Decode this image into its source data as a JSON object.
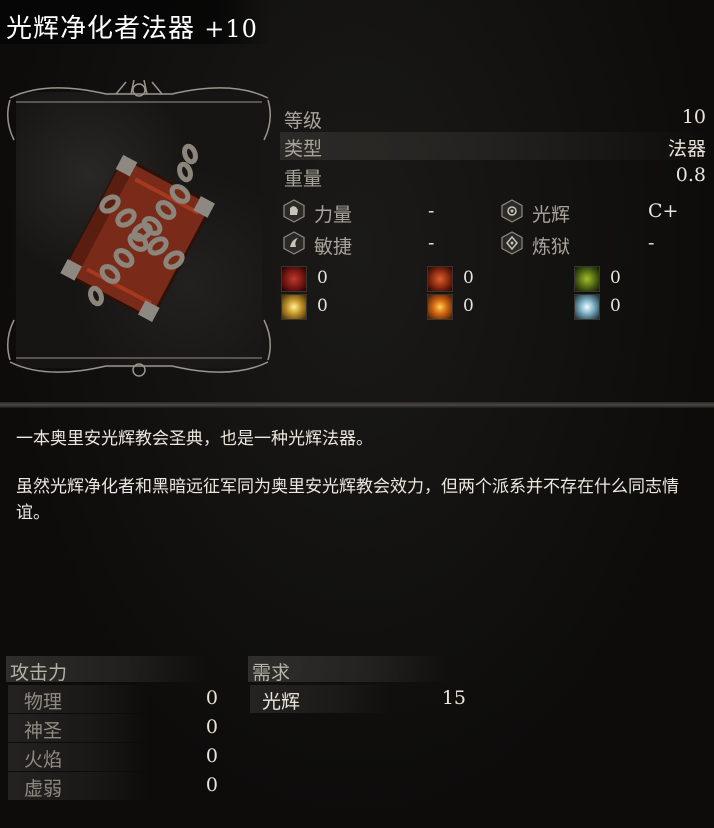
{
  "item": {
    "name": "光辉净化者法器",
    "upgrade": "+10",
    "icon": "chained-book-tome"
  },
  "stats": [
    {
      "label": "等级",
      "value": "10"
    },
    {
      "label": "类型",
      "value": "法器"
    },
    {
      "label": "重量",
      "value": "0.8"
    }
  ],
  "scaling": [
    {
      "label": "力量",
      "value": "-",
      "icon": "strength-icon"
    },
    {
      "label": "光辉",
      "value": "C+",
      "icon": "radiance-icon"
    },
    {
      "label": "敏捷",
      "value": "-",
      "icon": "dexterity-icon"
    },
    {
      "label": "炼狱",
      "value": "-",
      "icon": "infernal-icon"
    }
  ],
  "resistances": [
    {
      "icon": "bleed-icon",
      "value": "0",
      "color": "#8a1d1a"
    },
    {
      "icon": "fire-icon",
      "value": "0",
      "color": "#b5421a"
    },
    {
      "icon": "poison-icon",
      "value": "0",
      "color": "#6f8a1d"
    },
    {
      "icon": "holy-icon",
      "value": "0",
      "color": "#d8b33a"
    },
    {
      "icon": "burn-icon",
      "value": "0",
      "color": "#d46a12"
    },
    {
      "icon": "frost-icon",
      "value": "0",
      "color": "#a9d2e0"
    }
  ],
  "description": {
    "p1": "一本奥里安光辉教会圣典，也是一种光辉法器。",
    "p2": "虽然光辉净化者和黑暗远征军同为奥里安光辉教会效力，但两个派系并不存在什么同志情谊。"
  },
  "attack": {
    "header": "攻击力",
    "rows": [
      {
        "label": "物理",
        "value": "0"
      },
      {
        "label": "神圣",
        "value": "0"
      },
      {
        "label": "火焰",
        "value": "0"
      },
      {
        "label": "虚弱",
        "value": "0"
      }
    ]
  },
  "requirements": {
    "header": "需求",
    "rows": [
      {
        "label": "光辉",
        "value": "15"
      }
    ]
  }
}
